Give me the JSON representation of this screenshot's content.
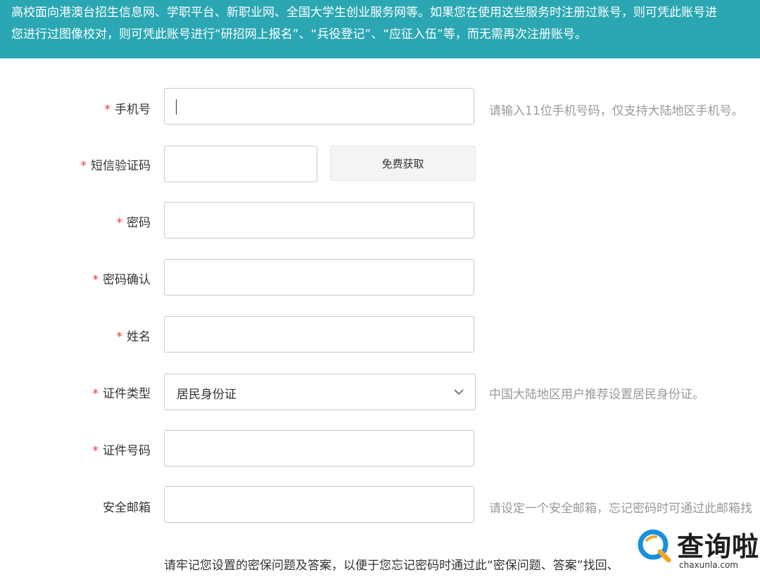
{
  "notice": {
    "line1": "高校面向港澳台招生信息网、学职平台、新职业网、全国大学生创业服务网等。如果您在使用这些服务时注册过账号，则可凭此账号进",
    "line2": "您进行过图像校对，则可凭此账号进行“研招网上报名”、“兵役登记”、“应征入伍”等，而无需再次注册账号。",
    "background_color": "#2aa7b3"
  },
  "form": {
    "required_mark": "*",
    "phone": {
      "label": "手机号",
      "value": "",
      "hint": "请输入11位手机号码，仅支持大陆地区手机号。"
    },
    "sms_code": {
      "label": "短信验证码",
      "value": "",
      "button_label": "免费获取"
    },
    "password": {
      "label": "密码",
      "value": ""
    },
    "password_confirm": {
      "label": "密码确认",
      "value": ""
    },
    "name": {
      "label": "姓名",
      "value": ""
    },
    "id_type": {
      "label": "证件类型",
      "selected": "居民身份证",
      "hint": "中国大陆地区用户推荐设置居民身份证。"
    },
    "id_number": {
      "label": "证件号码",
      "value": ""
    },
    "email": {
      "label": "安全邮箱",
      "value": "",
      "hint": "请设定一个安全邮箱，忘记密码时可通过此邮箱找"
    }
  },
  "security_note": "请牢记您设置的密保问题及答案，以便于您忘记密码时通过此“密保问题、答案”找回、",
  "watermark": {
    "title": "查询啦",
    "site": "chaxunla.com",
    "accent": "#1a8fe0"
  }
}
